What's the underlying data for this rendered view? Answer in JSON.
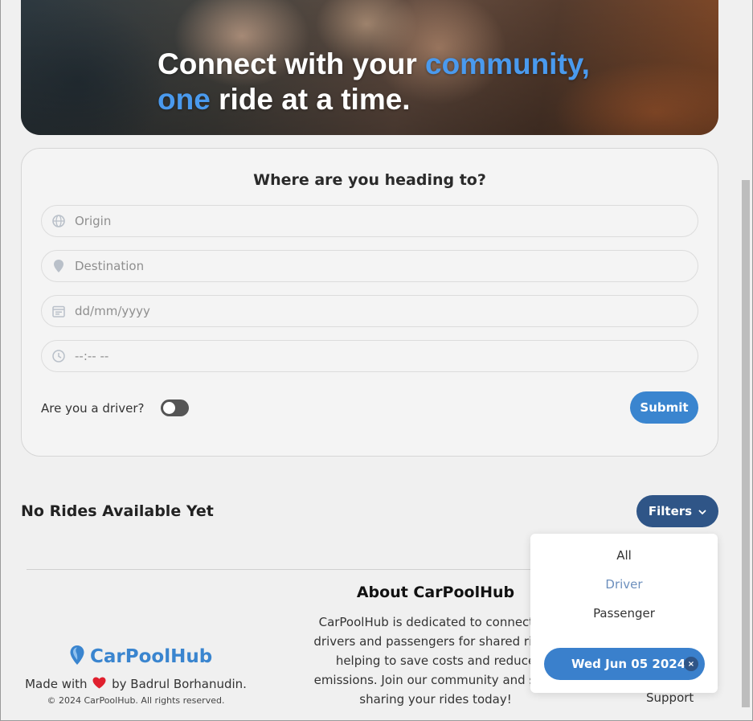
{
  "hero": {
    "line1_a": "Connect with your ",
    "line1_b": "community,",
    "line2_a": "one",
    "line2_b": " ride at a time."
  },
  "search": {
    "title": "Where are you heading to?",
    "origin_placeholder": "Origin",
    "destination_placeholder": "Destination",
    "date_placeholder": "dd/mm/yyyy",
    "time_placeholder": "--:-- --",
    "driver_label": "Are you a driver?",
    "driver_toggle_on": false,
    "submit_label": "Submit"
  },
  "rides": {
    "empty_label": "No Rides Available Yet",
    "filters_label": "Filters"
  },
  "filters_menu": {
    "items": [
      "All",
      "Driver",
      "Passenger"
    ],
    "selected": "Driver",
    "date_chip": "Wed Jun 05 2024",
    "chip_close": "×"
  },
  "footer": {
    "brand": "CarPoolHub",
    "made_with_prefix": "Made with",
    "made_with_suffix": "by Badrul Borhanudin.",
    "copyright": "© 2024 CarPoolHub. All rights reserved.",
    "about_title": "About CarPoolHub",
    "about_text": "CarPoolHub is dedicated to connecting drivers and passengers for shared rides, helping to save costs and reduce emissions. Join our community and start sharing your rides today!",
    "support_link": "Support"
  },
  "colors": {
    "accent": "#3a85cf",
    "filters_button": "#2f5587",
    "highlight_text": "#4a9aee"
  }
}
